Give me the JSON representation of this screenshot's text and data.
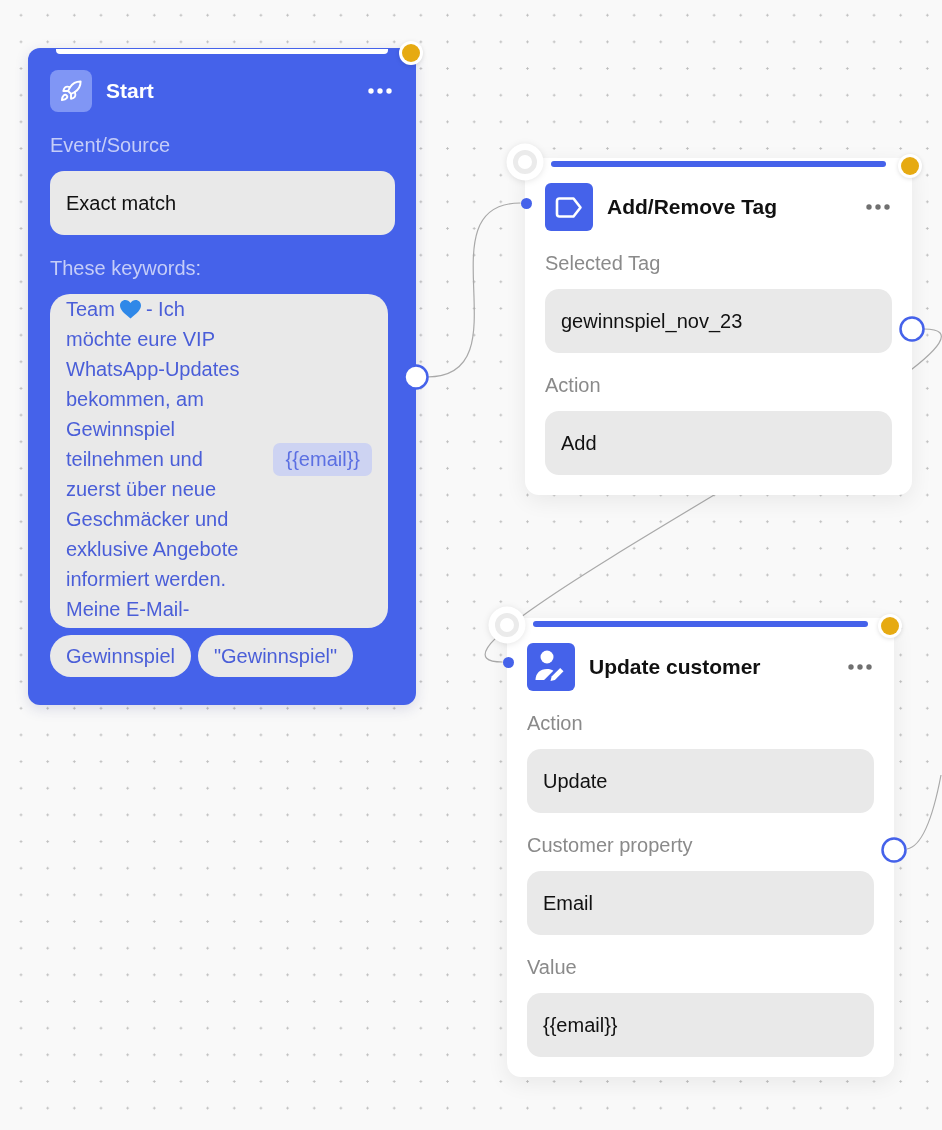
{
  "nodes": [
    {
      "kind": "start",
      "title": "Start",
      "fields": [
        {
          "label": "Event/Source",
          "value": "Exact match"
        }
      ],
      "keywords": {
        "label": "These keywords:",
        "first_line_start": "Team",
        "first_line_end": "- Ich",
        "text": "möchte eure VIP WhatsApp-Updates bekommen, am Gewinnspiel teilnehmen und zuerst über neue Geschmäcker und exklusive Angebote informiert werden. Meine E-Mail-",
        "variable": "{{email}}",
        "tags": [
          "Gewinnspiel",
          "\"Gewinnspiel\""
        ]
      }
    },
    {
      "kind": "tag",
      "title": "Add/Remove Tag",
      "fields": [
        {
          "label": "Selected Tag",
          "value": "gewinnspiel_nov_23"
        },
        {
          "label": "Action",
          "value": "Add"
        }
      ]
    },
    {
      "kind": "update_customer",
      "title": "Update customer",
      "fields": [
        {
          "label": "Action",
          "value": "Update"
        },
        {
          "label": "Customer property",
          "value": "Email"
        },
        {
          "label": "Value",
          "value": "{{email}}"
        }
      ]
    }
  ]
}
